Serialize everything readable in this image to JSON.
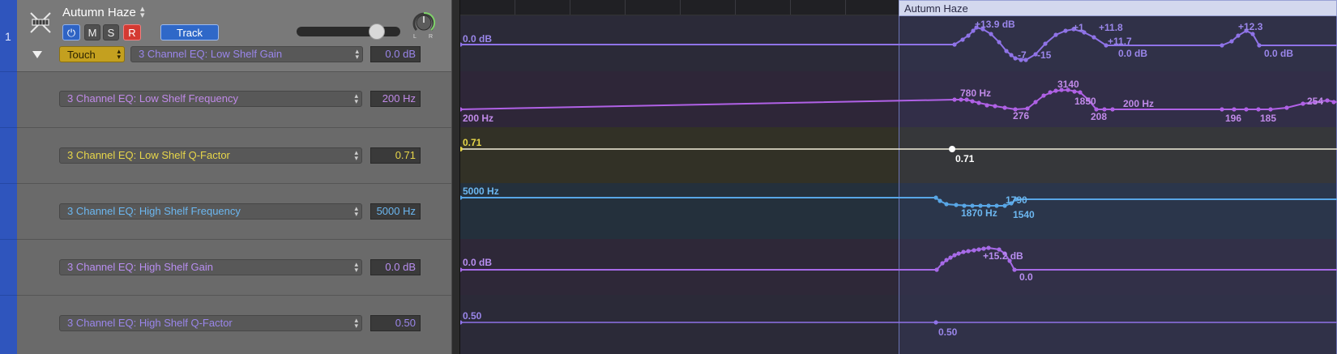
{
  "track": {
    "number": "1",
    "name": "Autumn Haze",
    "buttons": {
      "power": "⏻",
      "mute": "M",
      "solo": "S",
      "record": "R",
      "track": "Track"
    },
    "automation_mode": "Touch",
    "pan_left": "L",
    "pan_right": "R"
  },
  "lanes": [
    {
      "param": "3 Channel EQ: Low Shelf Gain",
      "value": "0.0 dB",
      "color": "#8f73e8",
      "text_color": "#9a86ea"
    },
    {
      "param": "3 Channel EQ: Low Shelf Frequency",
      "value": "200 Hz",
      "color": "#b061e6",
      "text_color": "#c08ae8"
    },
    {
      "param": "3 Channel EQ: Low Shelf Q-Factor",
      "value": "0.71",
      "color": "#f4f0dc",
      "text_color": "#e7d64a"
    },
    {
      "param": "3 Channel EQ: High Shelf Frequency",
      "value": "5000 Hz",
      "color": "#58a6e6",
      "text_color": "#6cb7f0"
    },
    {
      "param": "3 Channel EQ: High Shelf Gain",
      "value": "0.0 dB",
      "color": "#a76ae8",
      "text_color": "#b88ef0"
    },
    {
      "param": "3 Channel EQ: High Shelf Q-Factor",
      "value": "0.50",
      "color": "#8f73e8",
      "text_color": "#9a86ea"
    }
  ],
  "region": {
    "name": "Autumn Haze"
  },
  "automation": {
    "lane1": {
      "start_label": "0.0 dB",
      "labels": [
        "+13.9 dB",
        "-7",
        "-15",
        "+1",
        "+11.8",
        "+11.7",
        "0.0 dB",
        "+12.3",
        "0.0 dB"
      ]
    },
    "lane2": {
      "start_label": "200 Hz",
      "labels": [
        "780 Hz",
        "276",
        "3140",
        "1850",
        "208",
        "200 Hz",
        "196",
        "185",
        "254"
      ]
    },
    "lane3": {
      "start_label": "0.71",
      "labels": [
        "0.71"
      ]
    },
    "lane4": {
      "start_label": "5000 Hz",
      "labels": [
        "1870 Hz",
        "1790",
        "1540"
      ]
    },
    "lane5": {
      "start_label": "0.0 dB",
      "labels": [
        "+15.2 dB",
        "0.0"
      ]
    },
    "lane6": {
      "start_label": "0.50",
      "labels": [
        "0.50"
      ]
    }
  }
}
